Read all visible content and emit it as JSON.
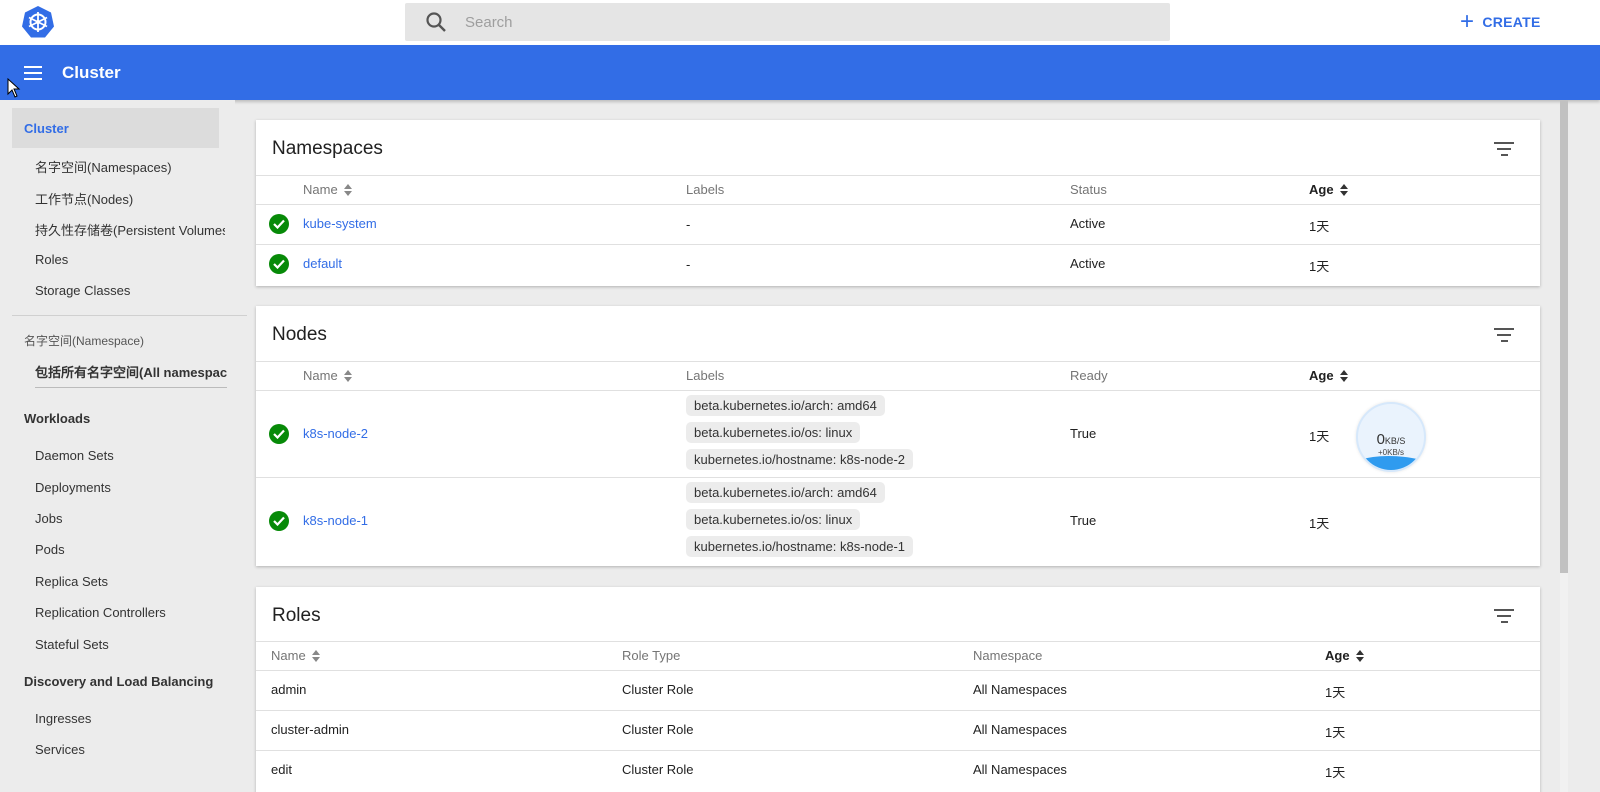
{
  "search": {
    "placeholder": "Search"
  },
  "topbar": {
    "create_label": "CREATE"
  },
  "header": {
    "title": "Cluster"
  },
  "sidebar": {
    "active": "Cluster",
    "cluster_items": [
      "名字空间(Namespaces)",
      "工作节点(Nodes)",
      "持久性存储卷(Persistent Volumes)",
      "Roles",
      "Storage Classes"
    ],
    "namespace_label": "名字空间(Namespace)",
    "namespace_value": "包括所有名字空间(All namespaces)",
    "workloads_title": "Workloads",
    "workload_items": [
      "Daemon Sets",
      "Deployments",
      "Jobs",
      "Pods",
      "Replica Sets",
      "Replication Controllers",
      "Stateful Sets"
    ],
    "discovery_title": "Discovery and Load Balancing",
    "discovery_items": [
      "Ingresses",
      "Services"
    ]
  },
  "namespaces": {
    "title": "Namespaces",
    "columns": {
      "name": "Name",
      "labels": "Labels",
      "status": "Status",
      "age": "Age"
    },
    "rows": [
      {
        "name": "kube-system",
        "labels": "-",
        "status": "Active",
        "age": "1天"
      },
      {
        "name": "default",
        "labels": "-",
        "status": "Active",
        "age": "1天"
      }
    ]
  },
  "nodes": {
    "title": "Nodes",
    "columns": {
      "name": "Name",
      "labels": "Labels",
      "ready": "Ready",
      "age": "Age"
    },
    "rows": [
      {
        "name": "k8s-node-2",
        "labels": [
          "beta.kubernetes.io/arch: amd64",
          "beta.kubernetes.io/os: linux",
          "kubernetes.io/hostname: k8s-node-2"
        ],
        "ready": "True",
        "age": "1天"
      },
      {
        "name": "k8s-node-1",
        "labels": [
          "beta.kubernetes.io/arch: amd64",
          "beta.kubernetes.io/os: linux",
          "kubernetes.io/hostname: k8s-node-1"
        ],
        "ready": "True",
        "age": "1天"
      }
    ]
  },
  "network_widget": {
    "value": "0",
    "unit": "KB/S",
    "sub": "+0KB/s"
  },
  "roles": {
    "title": "Roles",
    "columns": {
      "name": "Name",
      "type": "Role Type",
      "namespace": "Namespace",
      "age": "Age"
    },
    "rows": [
      {
        "name": "admin",
        "type": "Cluster Role",
        "namespace": "All Namespaces",
        "age": "1天"
      },
      {
        "name": "cluster-admin",
        "type": "Cluster Role",
        "namespace": "All Namespaces",
        "age": "1天"
      },
      {
        "name": "edit",
        "type": "Cluster Role",
        "namespace": "All Namespaces",
        "age": "1天"
      }
    ]
  },
  "colors": {
    "brand": "#326de6",
    "success": "#078a08"
  }
}
